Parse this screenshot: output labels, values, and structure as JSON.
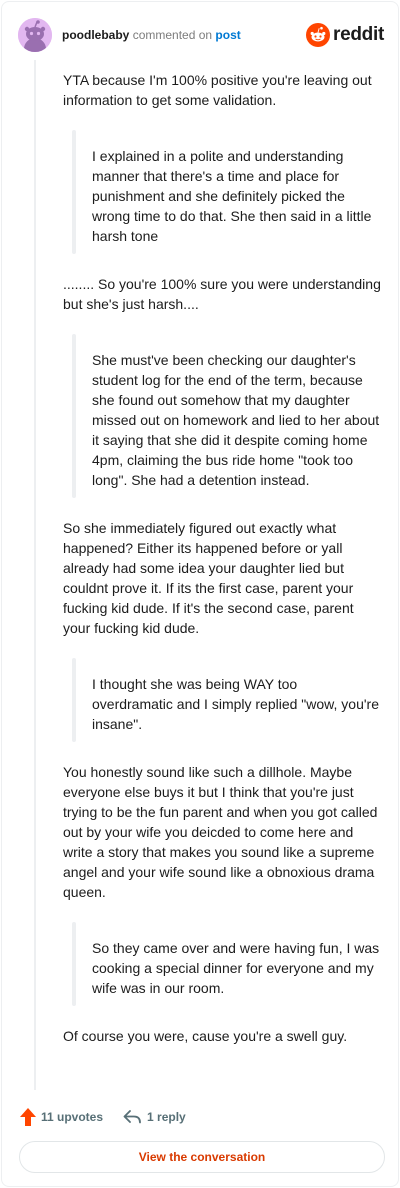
{
  "header": {
    "username": "poodlebaby",
    "verb": "commented on",
    "target": "post",
    "brand": "reddit"
  },
  "comment": {
    "p1": "YTA because I'm 100% positive you're leaving out information to get some validation.",
    "q1": "I explained in a polite and understanding manner that there's a time and place for punishment and she definitely picked the wrong time to do that. She then said in a little harsh tone",
    "p2": "........ So you're 100% sure you were understanding but she's just harsh....",
    "q2": "She must've been checking our daughter's student log for the end of the term, because she found out somehow that my daughter missed out on homework and lied to her about it saying that she did it despite coming home 4pm, claiming the bus ride home \"took too long\". She had a detention instead.",
    "p3": "So she immediately figured out exactly what happened? Either its happened before or yall already had some idea your daughter lied but couldnt prove it. If its the first case, parent your fucking kid dude. If it's the second case, parent your fucking kid dude.",
    "q3": "I thought she was being WAY too overdramatic and I simply replied \"wow, you're insane\".",
    "p4": "You honestly sound like such a dillhole. Maybe everyone else buys it but I think that you're just trying to be the fun parent and when you got called out by your wife you deicded to come here and write a story that makes you sound like a supreme angel and your wife sound like a obnoxious drama queen.",
    "q4": "So they came over and were having fun, I was cooking a special dinner for everyone and my wife was in our room.",
    "p5": "Of course you were, cause you're a swell guy."
  },
  "footer": {
    "upvotes": "11 upvotes",
    "replies": "1 reply",
    "view_label": "View the conversation"
  },
  "colors": {
    "brand": "#ff4500",
    "link": "#0079d3",
    "action_text": "#576f76",
    "button_text": "#d93a00"
  },
  "icons": {
    "avatar": "snoo-avatar-icon",
    "logo": "reddit-alien-icon",
    "upvote": "upvote-arrow-icon",
    "reply": "reply-arrow-icon"
  }
}
